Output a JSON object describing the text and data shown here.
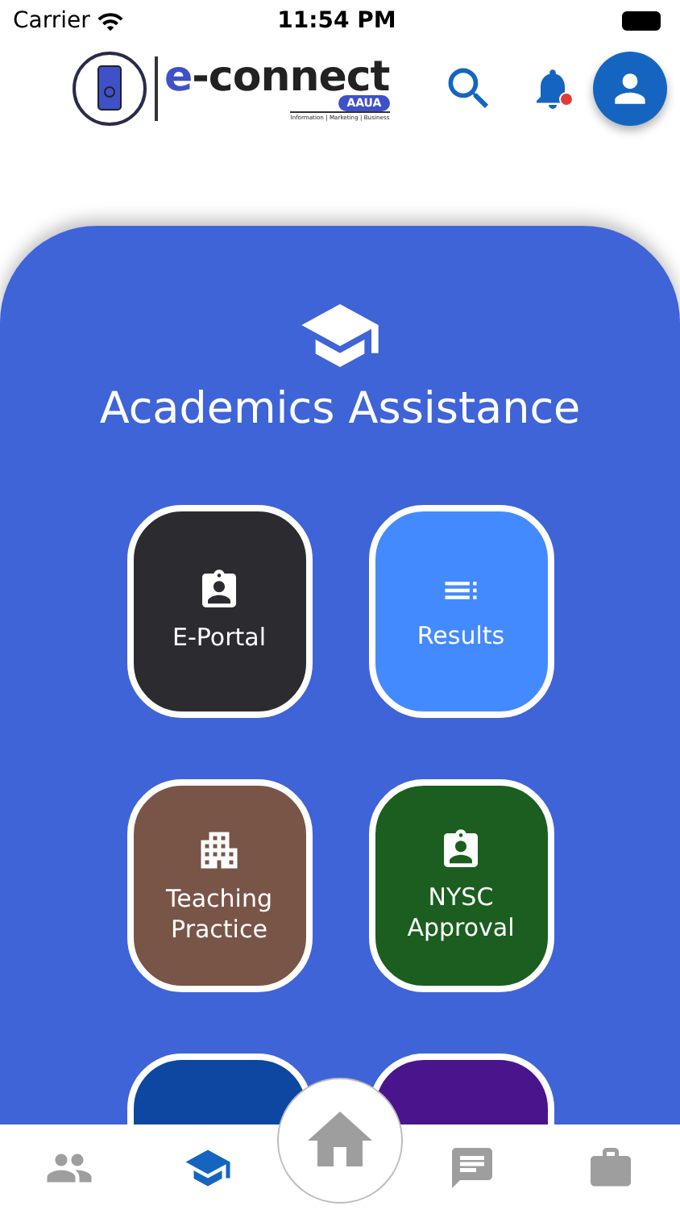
{
  "status_bar": {
    "carrier": "Carrier",
    "time": "11:54 PM"
  },
  "header": {
    "logo": {
      "brand_prefix": "e",
      "brand_rest": "-connect",
      "badge": "AAUA",
      "tagline": "Information | Marketing | Business"
    },
    "notification_unread": true
  },
  "section": {
    "title": "Academics Assistance"
  },
  "tiles": [
    {
      "label": "E-Portal",
      "kind": "badge",
      "color": "#2c2b2f"
    },
    {
      "label": "Results",
      "kind": "list",
      "color": "#448aff"
    },
    {
      "label": "Teaching Practice",
      "kind": "building",
      "color": "#795548"
    },
    {
      "label": "NYSC Approval",
      "kind": "badge",
      "color": "#1b5e20"
    },
    {
      "kind": "cut",
      "color": "#0d47a1"
    },
    {
      "kind": "cut",
      "color": "#4a148c"
    }
  ],
  "bottom_nav": [
    {
      "kind": "people",
      "selected": false
    },
    {
      "kind": "school",
      "selected": true
    },
    {
      "kind": "home",
      "selected": false
    },
    {
      "kind": "chat",
      "selected": false
    },
    {
      "kind": "work",
      "selected": false
    }
  ]
}
